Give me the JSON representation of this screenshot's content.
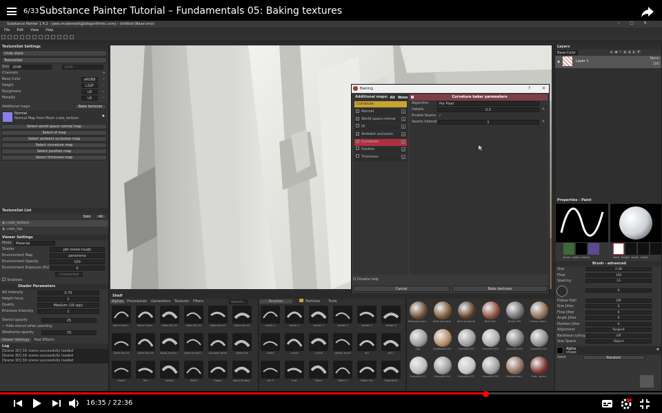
{
  "video": {
    "counter": "6/33",
    "title": "Substance Painter Tutorial – Fundamentals 05: Baking textures",
    "time": "16:35 / 22:36",
    "progress": 0.733
  },
  "app": {
    "title": "Substance Painter 1.4.2 – [wes.mcdermott@allegorithmic.com] – Untitled (Read only)",
    "menu": [
      "File",
      "Edit",
      "View",
      "Help"
    ]
  },
  "left": {
    "texset_header": "TextureSet Settings",
    "undo": "Undo stack",
    "texset": "TextureSet",
    "size_label": "Size",
    "size_val": "2048",
    "size_val2": "2048",
    "channels": "Channels",
    "channels_list": [
      {
        "name": "Base Color",
        "fmt": "sRGB8"
      },
      {
        "name": "Height",
        "fmt": "L32F"
      },
      {
        "name": "Roughness",
        "fmt": "L8"
      },
      {
        "name": "Metallic",
        "fmt": "L8"
      }
    ],
    "addmaps": "Additional maps",
    "bake": "Bake textures",
    "normal_title": "Normal",
    "normal_sub": "Normal Map from Mesh crate_bottom",
    "selects": [
      "Select world space normal map",
      "Select id map",
      "Select ambient occlusion map",
      "Select curvature map",
      "Select position map",
      "Select thickness map"
    ],
    "tslist_header": "TextureSet List",
    "solo": "Solo",
    "all": "All",
    "ts": [
      "crate_bottom",
      "crate_top"
    ],
    "viewer_header": "Viewer Settings",
    "mode_label": "Mode",
    "mode_val": "Material",
    "viewer_rows": [
      {
        "k": "Shader",
        "v": "pbr-metal-rough"
      },
      {
        "k": "Environment Map",
        "v": "panorama"
      },
      {
        "k": "Environment Opacity",
        "v": "100"
      },
      {
        "k": "Environment Exposure (EV)",
        "v": "0"
      }
    ],
    "rotation": "Unselected",
    "shadows": "Shadows",
    "shader_params": "Shader Parameters",
    "shader_rows": [
      {
        "k": "AO Intensity",
        "v": "0.75"
      },
      {
        "k": "Height force",
        "v": "1"
      },
      {
        "k": "Quality",
        "v": "Medium (16 spp)"
      },
      {
        "k": "Emissive Intensity",
        "v": "1"
      }
    ],
    "stencil": "Stencil opacity",
    "stencil_v": "25",
    "hide_stencil": "Hide stencil when painting",
    "wire": "Wireframe opacity",
    "wire_v": "70",
    "tabs": [
      "Viewer Settings",
      "Post Effects"
    ],
    "log_header": "Log",
    "log": [
      "[Scene 3D] 3D scene successfully loaded",
      "[Scene 3D] 3D scene successfully loaded",
      "[Scene 3D] 3D scene successfully loaded"
    ]
  },
  "dialog": {
    "title": "Baking",
    "help": "?",
    "close": "✕",
    "addmaps": "Additional maps:",
    "all": "All",
    "none": "None",
    "selected": "Curvature",
    "maps": [
      {
        "name": "Normal",
        "checked": true
      },
      {
        "name": "World space normal",
        "checked": true
      },
      {
        "name": "ID",
        "checked": false
      },
      {
        "name": "Ambient occlusion",
        "checked": true
      },
      {
        "name": "Curvature",
        "checked": true
      },
      {
        "name": "Position",
        "checked": false
      },
      {
        "name": "Thickness",
        "checked": false
      }
    ],
    "params_title": "Curvature baker parameters",
    "params": [
      {
        "k": "Algorithm",
        "v": "Per Pixel"
      },
      {
        "k": "Details",
        "v": "0.5"
      },
      {
        "k": "Enable Seams",
        "v": "✓"
      },
      {
        "k": "Seams Intensity",
        "v": "1"
      }
    ],
    "disable_help": "Disable help",
    "cancel": "Cancel",
    "bake": "Bake textures"
  },
  "right": {
    "layers_header": "Layers",
    "blend": "Base Color",
    "layer_name": "Layer 1",
    "layer_mode": "Norm",
    "layer_op": "100",
    "props_header": "Properties - Paint",
    "chips": [
      "brush",
      "alpha",
      "stencil"
    ],
    "mats": [
      "color",
      "height",
      "rough",
      "metal"
    ],
    "brush_adv": "Brush - advanced",
    "props": [
      {
        "k": "Size",
        "v": "2.38"
      },
      {
        "k": "Flow",
        "v": "100"
      },
      {
        "k": "Spacing",
        "v": "10"
      },
      {
        "k": "Angle",
        "v": "0"
      },
      {
        "k": "Follow Path",
        "v": "Off"
      },
      {
        "k": "Size Jitter",
        "v": "0"
      },
      {
        "k": "Flow Jitter",
        "v": "0"
      },
      {
        "k": "Angle Jitter",
        "v": "0"
      },
      {
        "k": "Position Jitter",
        "v": "0"
      },
      {
        "k": "Alignment",
        "v": "Tangent"
      },
      {
        "k": "Backface culling",
        "v": "Off"
      },
      {
        "k": "Size Space",
        "v": "Object"
      }
    ],
    "alpha": "Alpha",
    "shape": "shape",
    "seed": "Seed",
    "seed_v": "Random"
  },
  "shelf": {
    "header": "Shelf",
    "tabs": [
      "Alphas",
      "Procedurals",
      "Generators",
      "Textures",
      "Filters"
    ],
    "search": "Search...",
    "brushtabs": [
      "Brushes",
      "Particles",
      "Tools"
    ],
    "alphas": [
      "Alpha Crack...",
      "Alpha Crack...",
      "Alpha Dirt 01",
      "Alpha Dirt 02",
      "Alpha Dirt 03",
      "Alpha Dirt 04",
      "Alpha Dirt 05",
      "Alpha Dirt 06",
      "Alpha_scratch...",
      "Alpha Scratch...",
      "Gaussian Noise",
      "Shape line",
      "Hatch",
      "Pen",
      "Splash",
      "Stitch",
      "Zipper",
      "Alpha Stripes..."
    ],
    "brushes": [
      "artistic 1",
      "artistic 2",
      "artistic 3",
      "artistic 4",
      "artistic 5",
      "artistic 6",
      "cotton",
      "cracks",
      "crystal",
      "default brush",
      "dirt",
      "dirt 2",
      "dirt 3",
      "dust",
      "Fibers",
      "Fibers 2",
      "Fibers line",
      "fingerprint"
    ],
    "materials": [
      "Backpack pad...",
      "Bark dark pine",
      "Bark old grime",
      "Brick 001",
      "Bricks 005",
      "Cannon bark...",
      "Cap",
      "Cardboard 001",
      "Concrete 002",
      "Concrete 003",
      "Concrete 009",
      "Concrete 010",
      "Concrete 011",
      "Concrete 044",
      "Concrete 072",
      "Concrete 093",
      "Concrete pai...",
      "Crab...toned"
    ]
  }
}
